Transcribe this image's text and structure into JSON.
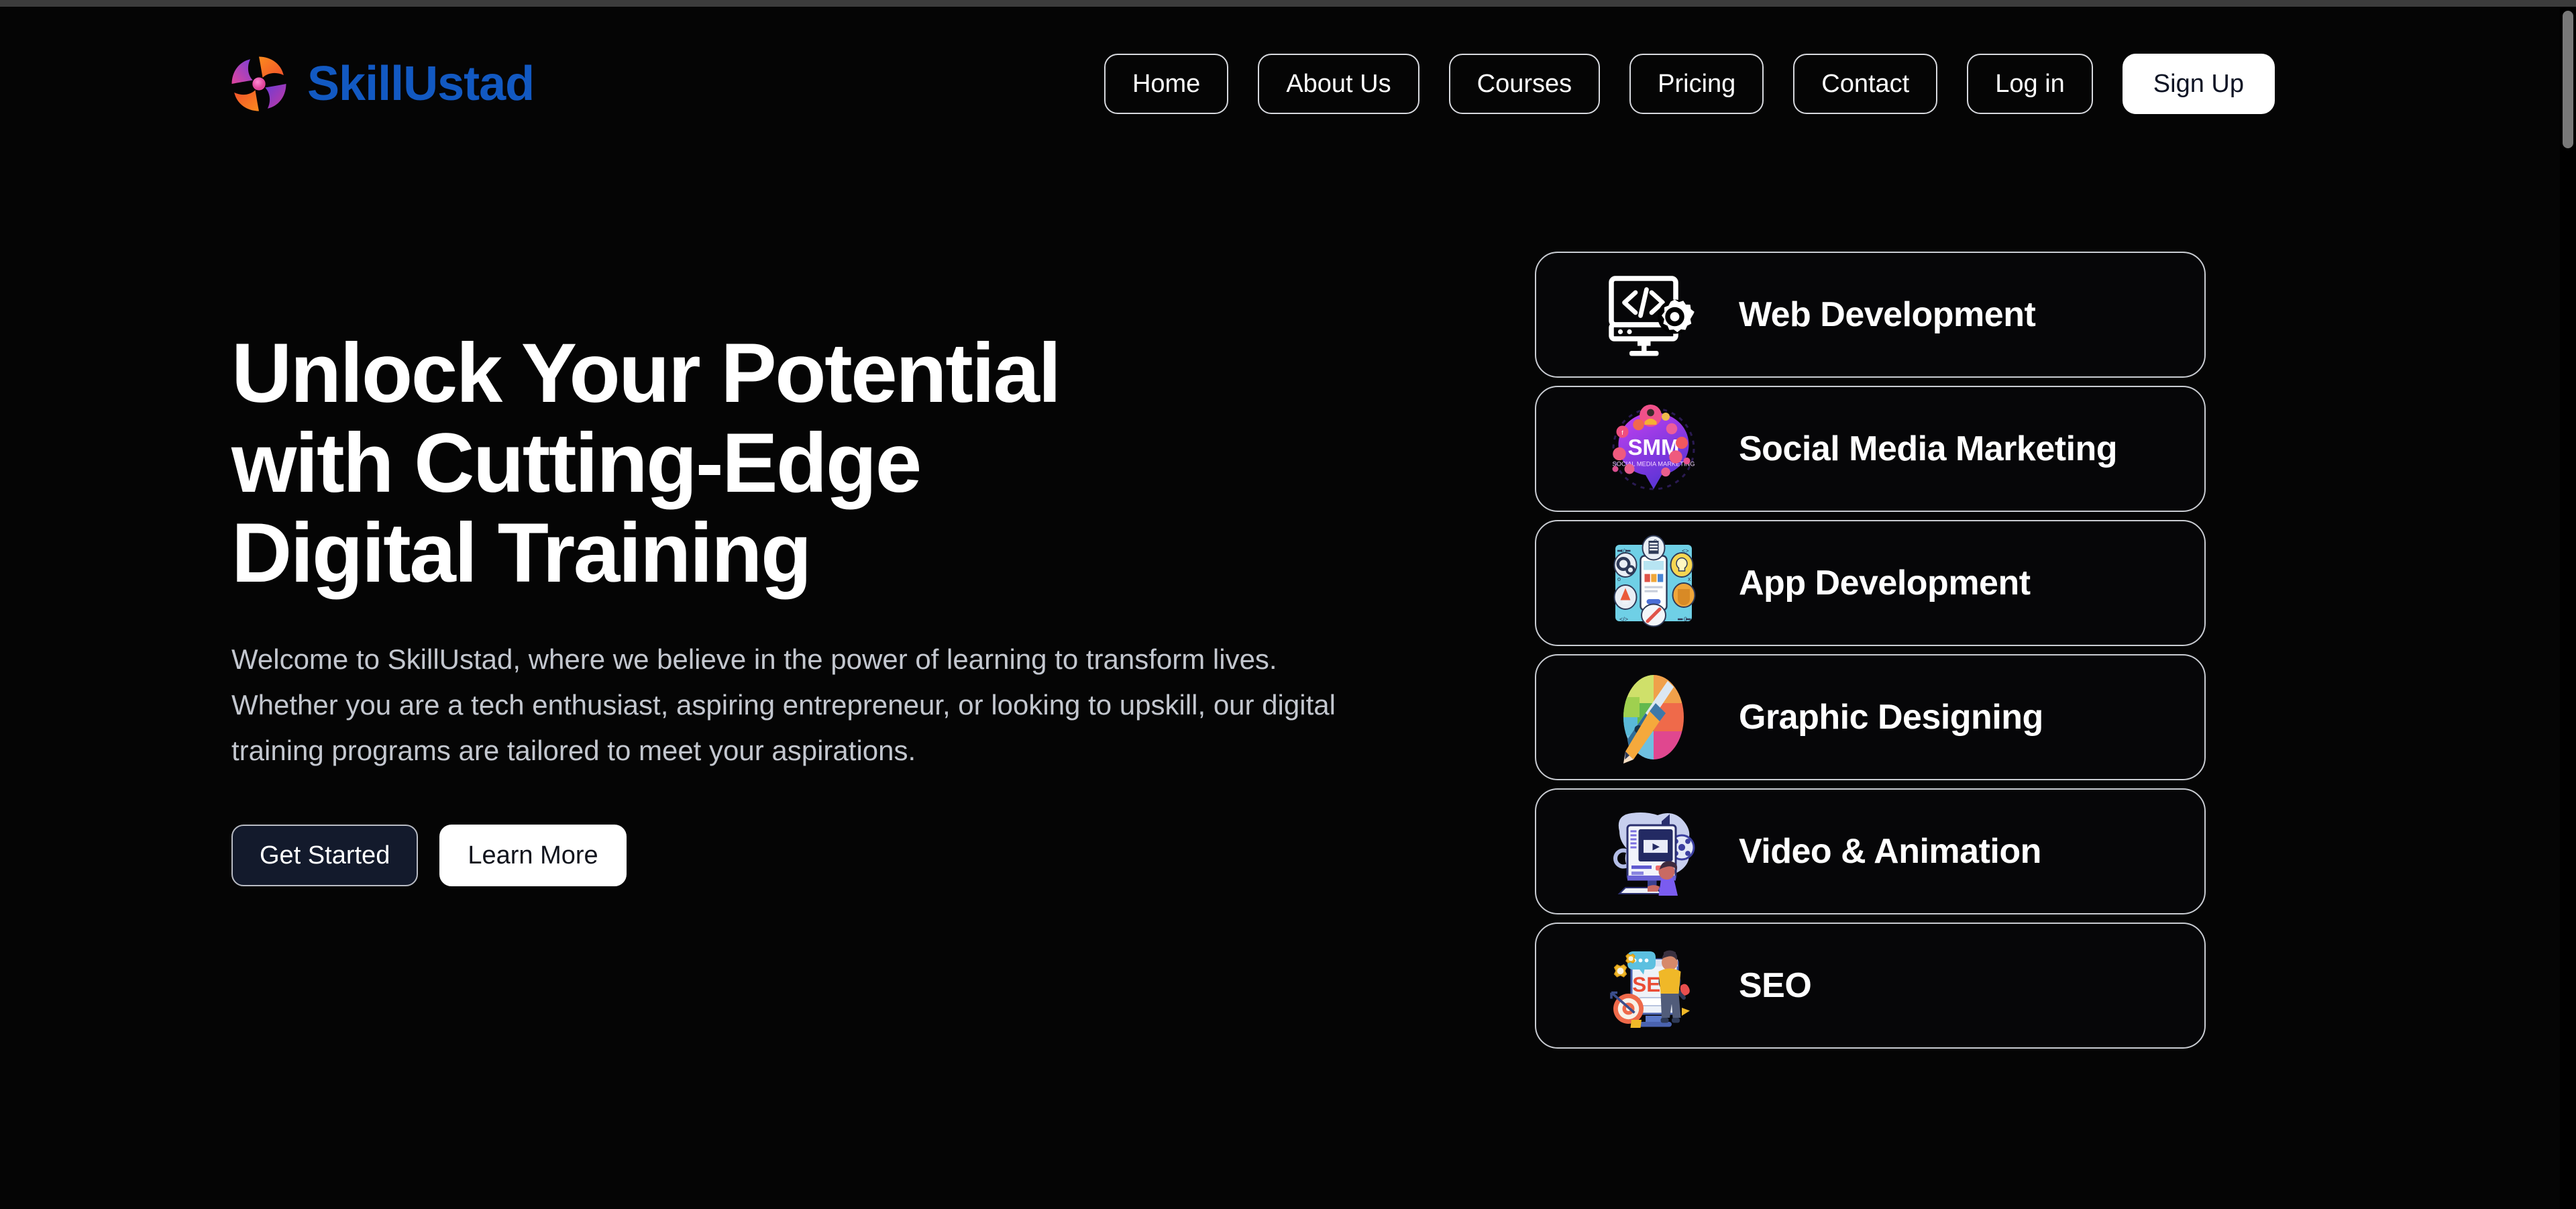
{
  "brand": {
    "name": "SkillUstad",
    "name_color": "#1259c2",
    "mark_colors": [
      "#f97316",
      "#ec4899",
      "#7c3aed"
    ]
  },
  "nav": {
    "items": [
      {
        "label": "Home",
        "style": "outline"
      },
      {
        "label": "About Us",
        "style": "outline"
      },
      {
        "label": "Courses",
        "style": "outline"
      },
      {
        "label": "Pricing",
        "style": "outline"
      },
      {
        "label": "Contact",
        "style": "outline"
      },
      {
        "label": "Log in",
        "style": "outline"
      },
      {
        "label": "Sign Up",
        "style": "filled"
      }
    ]
  },
  "hero": {
    "title_line1": "Unlock Your Potential",
    "title_line2": "with Cutting-Edge",
    "title_line3": "Digital Training",
    "paragraph": "Welcome to SkillUstad, where we believe in the power of learning to transform lives. Whether you are a tech enthusiast, aspiring entrepreneur, or looking to upskill, our digital training programs are tailored to meet your aspirations.",
    "primary_cta": "Get Started",
    "secondary_cta": "Learn More",
    "title_color": "#ffffff",
    "paragraph_color": "#c3c7cf"
  },
  "services": {
    "cards": [
      {
        "label": "Web Development",
        "icon": "code-monitor-gear-icon"
      },
      {
        "label": "Social Media Marketing",
        "icon": "smm-speech-bubble-icon"
      },
      {
        "label": "App Development",
        "icon": "mobile-app-icon"
      },
      {
        "label": "Graphic Designing",
        "icon": "color-wheel-pen-pencil-icon"
      },
      {
        "label": "Video & Animation",
        "icon": "video-editing-icon"
      },
      {
        "label": "SEO",
        "icon": "seo-magnifier-icon"
      }
    ]
  },
  "scrollbar": {
    "thumb_color": "#787878"
  }
}
